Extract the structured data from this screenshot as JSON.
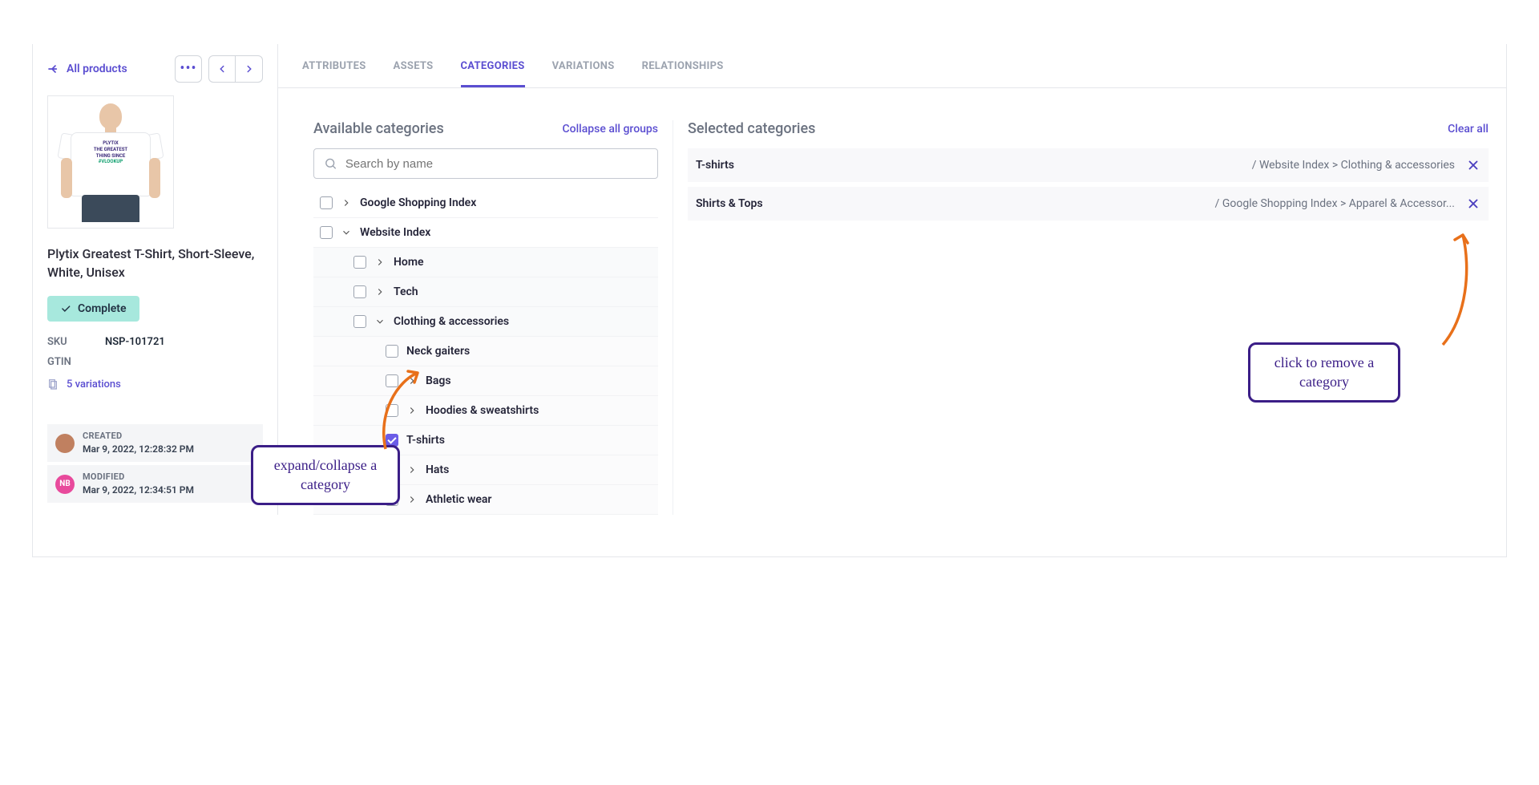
{
  "back_label": "All products",
  "product": {
    "title": "Plytix Greatest T-Shirt, Short-Sleeve, White, Unisex",
    "image_print_line1": "PLYTIX",
    "image_print_line2": "THE GREATEST",
    "image_print_line3": "THING SINCE",
    "image_print_line4": "#VLOOKUP",
    "status_label": "Complete",
    "sku_label": "SKU",
    "sku_value": "NSP-101721",
    "gtin_label": "GTIN",
    "gtin_value": "",
    "variations_label": "5 variations"
  },
  "audit": {
    "created_label": "CREATED",
    "created_at": "Mar 9, 2022, 12:28:32 PM",
    "modified_label": "MODIFIED",
    "modified_at": "Mar 9, 2022, 12:34:51 PM",
    "modified_avatar_initials": "NB"
  },
  "tabs": {
    "attributes": "ATTRIBUTES",
    "assets": "ASSETS",
    "categories": "CATEGORIES",
    "variations": "VARIATIONS",
    "relationships": "RELATIONSHIPS"
  },
  "available": {
    "title": "Available categories",
    "collapse_link": "Collapse all groups",
    "search_placeholder": "Search by name",
    "nodes": {
      "google_shopping": "Google Shopping Index",
      "website_index": "Website Index",
      "home": "Home",
      "tech": "Tech",
      "clothing": "Clothing & accessories",
      "neck_gaiters": "Neck gaiters",
      "bags": "Bags",
      "hoodies": "Hoodies & sweatshirts",
      "tshirts": "T-shirts",
      "hats": "Hats",
      "athletic": "Athletic wear"
    }
  },
  "selected": {
    "title": "Selected categories",
    "clear_link": "Clear all",
    "items": [
      {
        "name": "T-shirts",
        "path": "/ Website Index > Clothing & accessories"
      },
      {
        "name": "Shirts & Tops",
        "path": "/ Google Shopping Index > Apparel & Accessor..."
      }
    ]
  },
  "annotations": {
    "expand": "expand/collapse a category",
    "remove": "click to remove a category"
  }
}
